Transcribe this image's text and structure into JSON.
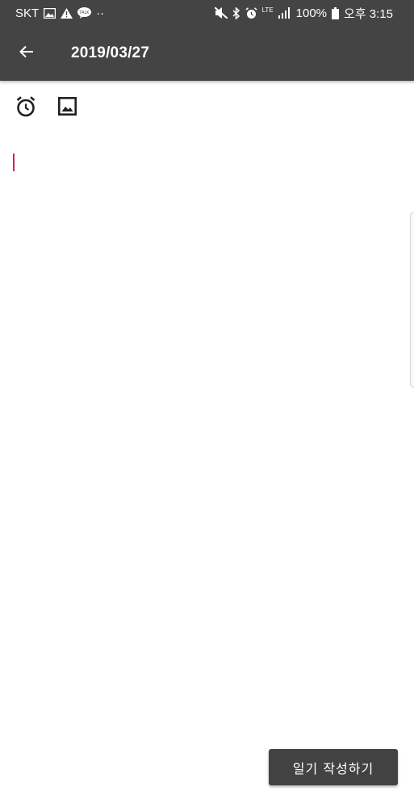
{
  "status_bar": {
    "carrier": "SKT",
    "dots": "··",
    "network": "LTE",
    "battery": "100%",
    "time": "오후 3:15",
    "left_icons": [
      "image-icon",
      "warning-icon",
      "talk-icon"
    ],
    "right_icons": [
      "mute-icon",
      "bluetooth-icon",
      "alarm-icon",
      "lte-icon",
      "signal-icon",
      "battery-icon"
    ]
  },
  "app_bar": {
    "title": "2019/03/27",
    "back_icon": "arrow-left-icon",
    "background": "#444444"
  },
  "toolbar": {
    "icons": [
      "alarm-icon",
      "image-icon"
    ]
  },
  "editor": {
    "text": "",
    "caret_color": "#d81b60"
  },
  "footer": {
    "write_button_label": "일기 작성하기",
    "button_color": "#424242"
  }
}
